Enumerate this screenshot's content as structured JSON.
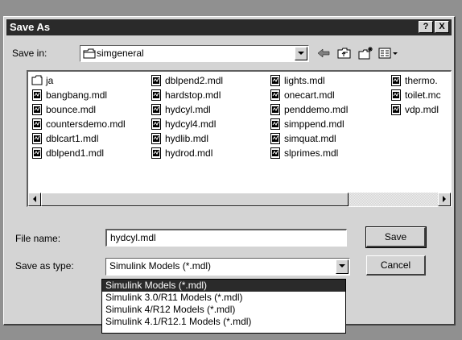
{
  "dialog": {
    "title": "Save As",
    "help_label": "?",
    "close_label": "X"
  },
  "save_in": {
    "label": "Save in:",
    "folder": "simgeneral"
  },
  "toolbar": {
    "icons": [
      "back-arrow-icon",
      "up-folder-icon",
      "new-folder-icon",
      "view-menu-icon"
    ]
  },
  "files": [
    [
      "ja",
      "bangbang.mdl",
      "bounce.mdl",
      "countersdemo.mdl",
      "dblcart1.mdl",
      "dblpend1.mdl"
    ],
    [
      "dblpend2.mdl",
      "hardstop.mdl",
      "hydcyl.mdl",
      "hydcyl4.mdl",
      "hydlib.mdl",
      "hydrod.mdl"
    ],
    [
      "lights.mdl",
      "onecart.mdl",
      "penddemo.mdl",
      "simppend.mdl",
      "simquat.mdl",
      "slprimes.mdl"
    ],
    [
      "thermo.",
      "toilet.mc",
      "vdp.mdl"
    ]
  ],
  "file_name": {
    "label": "File name:",
    "value": "hydcyl.mdl"
  },
  "save_type": {
    "label": "Save as type:",
    "value": "Simulink Models (*.mdl)",
    "options": [
      "Simulink Models (*.mdl)",
      "Simulink 3.0/R11 Models (*.mdl)",
      "Simulink 4/R12 Models (*.mdl)",
      "Simulink 4.1/R12.1 Models (*.mdl)"
    ],
    "selected_index": 0
  },
  "buttons": {
    "save": "Save",
    "cancel": "Cancel"
  },
  "colors": {
    "titlebar": "#2a2a2a",
    "face": "#d4d4d4",
    "background": "#909090"
  }
}
